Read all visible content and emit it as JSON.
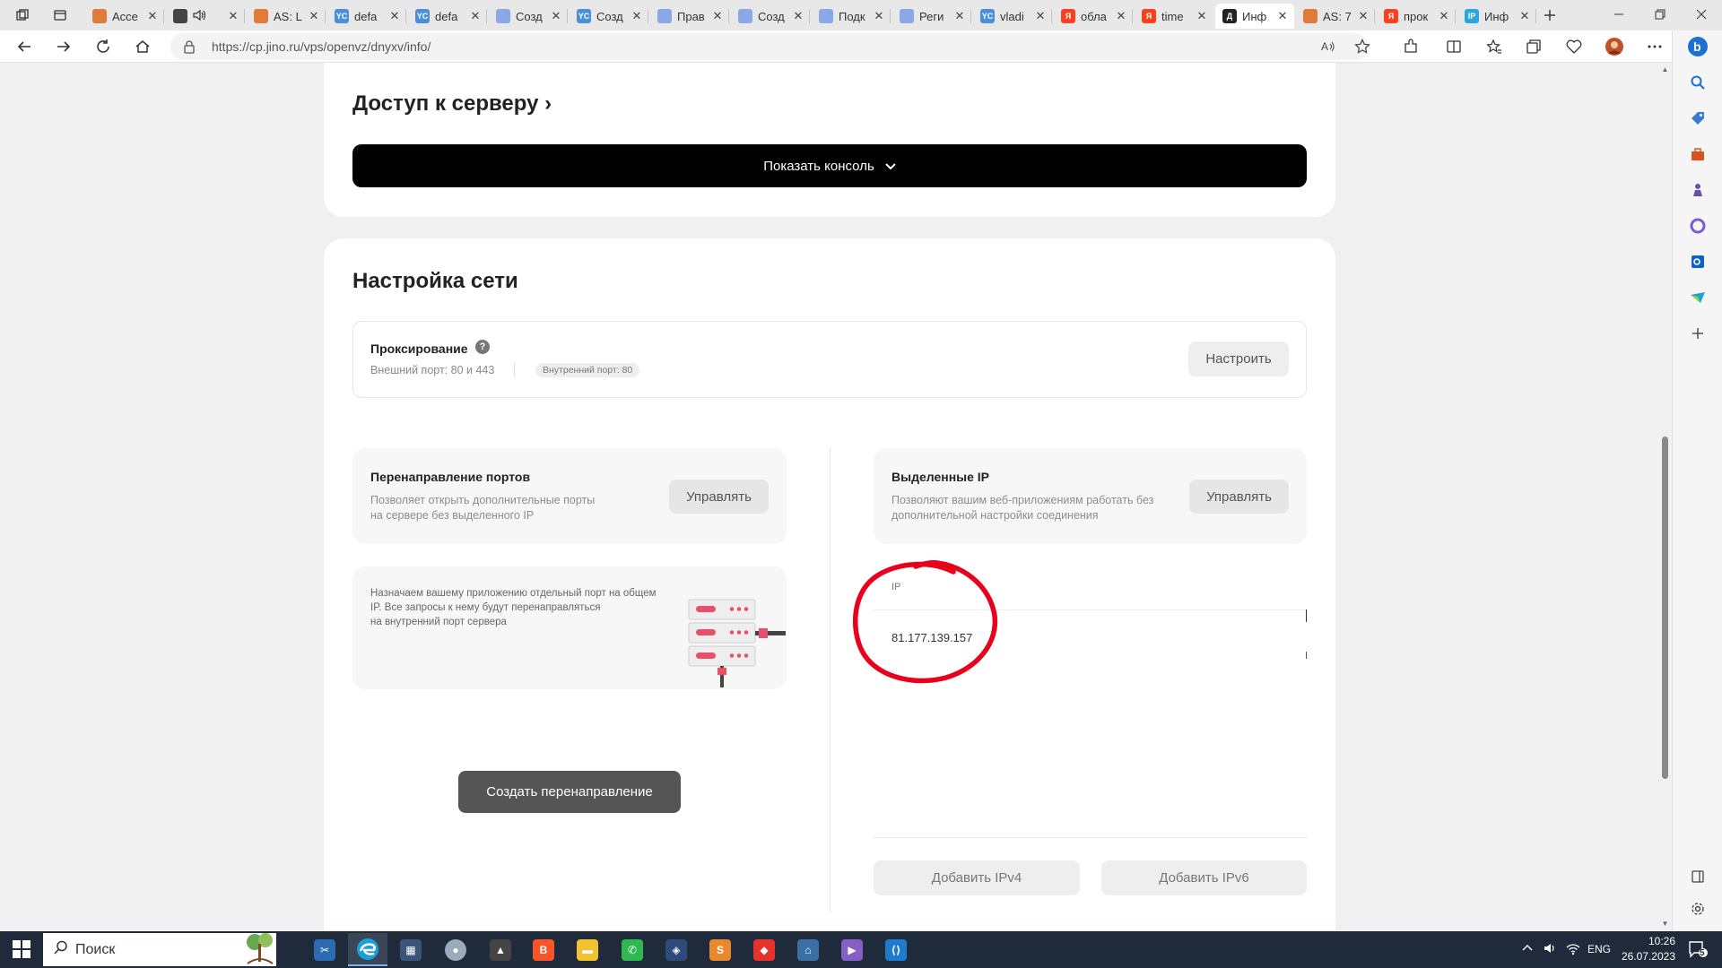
{
  "browser": {
    "tabs": [
      {
        "label": "Acce",
        "fav_text": "",
        "fav_color": "#e07b39"
      },
      {
        "label": "",
        "fav_text": "",
        "fav_color": "#444444"
      },
      {
        "label": "AS: L",
        "fav_text": "",
        "fav_color": "#e07b39"
      },
      {
        "label": "defa",
        "fav_text": "YC",
        "fav_color": "#4a8fd8"
      },
      {
        "label": "defa",
        "fav_text": "YC",
        "fav_color": "#4a8fd8"
      },
      {
        "label": "Созд",
        "fav_text": "",
        "fav_color": "#8aa7e6"
      },
      {
        "label": "Созд",
        "fav_text": "YC",
        "fav_color": "#4a8fd8"
      },
      {
        "label": "Прав",
        "fav_text": "",
        "fav_color": "#8aa7e6"
      },
      {
        "label": "Созд",
        "fav_text": "",
        "fav_color": "#8aa7e6"
      },
      {
        "label": "Подк",
        "fav_text": "",
        "fav_color": "#8aa7e6"
      },
      {
        "label": "Реги",
        "fav_text": "",
        "fav_color": "#8aa7e6"
      },
      {
        "label": "vladi",
        "fav_text": "YC",
        "fav_color": "#4a8fd8"
      },
      {
        "label": "обла",
        "fav_text": "Я",
        "fav_color": "#fc3f1d"
      },
      {
        "label": "time",
        "fav_text": "Я",
        "fav_color": "#fc3f1d"
      },
      {
        "label": "Инф",
        "fav_text": "Д",
        "fav_color": "#222222"
      },
      {
        "label": "AS: 7",
        "fav_text": "",
        "fav_color": "#e07b39"
      },
      {
        "label": "прок",
        "fav_text": "Я",
        "fav_color": "#fc3f1d"
      },
      {
        "label": "Инф",
        "fav_text": "IP",
        "fav_color": "#2aa6df"
      }
    ],
    "url": "https://cp.jino.ru/vps/openvz/dnyxv/info/"
  },
  "page": {
    "access": {
      "title": "Доступ к серверу",
      "title_arrow": "›",
      "console_button": "Показать консоль"
    },
    "network": {
      "title": "Настройка сети",
      "proxy": {
        "title": "Проксирование",
        "help": "?",
        "external_port": "Внешний порт: 80 и 443",
        "internal_port_badge": "Внутренний порт: 80",
        "configure_button": "Настроить"
      },
      "port_forwarding": {
        "title": "Перенаправление портов",
        "desc_line1": "Позволяет открыть дополнительные порты",
        "desc_line2": "на сервере без выделенного IP",
        "manage_button": "Управлять",
        "info_line1": "Назначаем вашему приложению отдельный порт на общем",
        "info_line2": "IP. Все запросы к нему будут перенаправляться",
        "info_line3": "на внутренний порт сервера",
        "create_button": "Создать перенаправление"
      },
      "dedicated_ip": {
        "title": "Выделенные IP",
        "desc_line1": "Позволяют вашим веб-приложениям работать без",
        "desc_line2": "дополнительной настройки соединения",
        "manage_button": "Управлять",
        "column_header": "IP",
        "ip_value": "81.177.139.157",
        "add_ipv4_button": "Добавить IPv4",
        "add_ipv6_button": "Добавить IPv6"
      }
    }
  },
  "taskbar": {
    "search_placeholder": "Поиск",
    "language": "ENG",
    "time": "10:26",
    "date": "26.07.2023",
    "notification_count": "5"
  },
  "colors": {
    "accent_red": "#e8001c",
    "server_pink": "#e8506a"
  }
}
